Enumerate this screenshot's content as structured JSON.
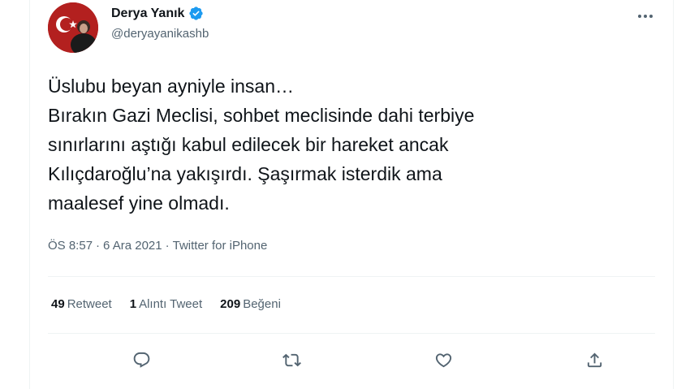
{
  "user": {
    "display_name": "Derya Yanık",
    "handle": "@deryayanikashb",
    "verified": true,
    "avatar_icon": "profile-photo-with-turkish-flag"
  },
  "tweet": {
    "lines": [
      "Üslubu beyan ayniyle insan…",
      "Bırakın Gazi Meclisi, sohbet meclisinde dahi terbiye",
      "sınırlarını aştığı kabul edilecek bir hareket ancak",
      "Kılıçdaroğlu’na yakışırdı. Şaşırmak isterdik ama",
      "maalesef yine olmadı."
    ],
    "time": "ÖS 8:57",
    "separator1": "·",
    "date": "6 Ara 2021",
    "separator2": "·",
    "source": "Twitter for iPhone"
  },
  "stats": {
    "retweets": {
      "count": "49",
      "label": "Retweet"
    },
    "quotes": {
      "count": "1",
      "label": "Alıntı Tweet"
    },
    "likes": {
      "count": "209",
      "label": "Beğeni"
    }
  },
  "icons": {
    "more": "more-horizontal-icon",
    "reply": "reply-icon",
    "retweet": "retweet-icon",
    "like": "heart-icon",
    "share": "share-icon",
    "verified": "verified-badge-icon"
  },
  "colors": {
    "text": "#0f1419",
    "secondary": "#536471",
    "verified": "#1d9bf0",
    "divider": "#eff3f4"
  }
}
